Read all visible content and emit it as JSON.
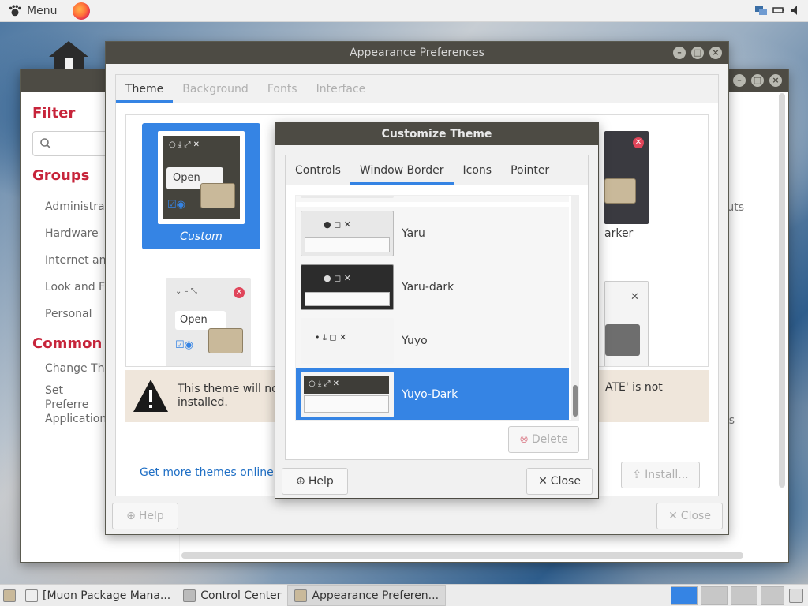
{
  "top_panel": {
    "menu_label": "Menu"
  },
  "bottom_panel": {
    "tasks": [
      {
        "label": "[Muon Package Mana..."
      },
      {
        "label": "Control Center"
      },
      {
        "label": "Appearance Preferen..."
      }
    ]
  },
  "control_center": {
    "filter_heading": "Filter",
    "groups_heading": "Groups",
    "groups": [
      "Administrat",
      "Hardware",
      "Internet and",
      "Look and Fe",
      "Personal"
    ],
    "common_heading": "Common Ta",
    "common_items": [
      "Change The",
      "Set Preferre Application"
    ],
    "right_text_1": "uts",
    "right_text_2": "s"
  },
  "appearance": {
    "title": "Appearance Preferences",
    "tabs": [
      "Theme",
      "Background",
      "Fonts",
      "Interface"
    ],
    "selected_tab": "Theme",
    "themes": [
      {
        "name": "Custom"
      },
      {
        "name": "arker"
      }
    ],
    "open_label": "Open",
    "warning_text": "This theme will not",
    "warning_text_2": "installed.",
    "warning_text_right": "ATE' is not",
    "get_more_link": "Get more themes online",
    "install_label": "Install...",
    "help_label": "Help",
    "close_label": "Close"
  },
  "customize_theme": {
    "title": "Customize Theme",
    "tabs": [
      "Controls",
      "Window Border",
      "Icons",
      "Pointer"
    ],
    "selected_tab": "Window Border",
    "border_themes": [
      {
        "name": "Yaru"
      },
      {
        "name": "Yaru-dark"
      },
      {
        "name": "Yuyo"
      },
      {
        "name": "Yuyo-Dark"
      }
    ],
    "selected_theme": "Yuyo-Dark",
    "delete_label": "Delete",
    "help_label": "Help",
    "close_label": "Close"
  },
  "colors": {
    "accent": "#3584e4",
    "titlebar": "#4d4b44",
    "heading_red": "#c7243a",
    "link": "#1f6fc5"
  }
}
